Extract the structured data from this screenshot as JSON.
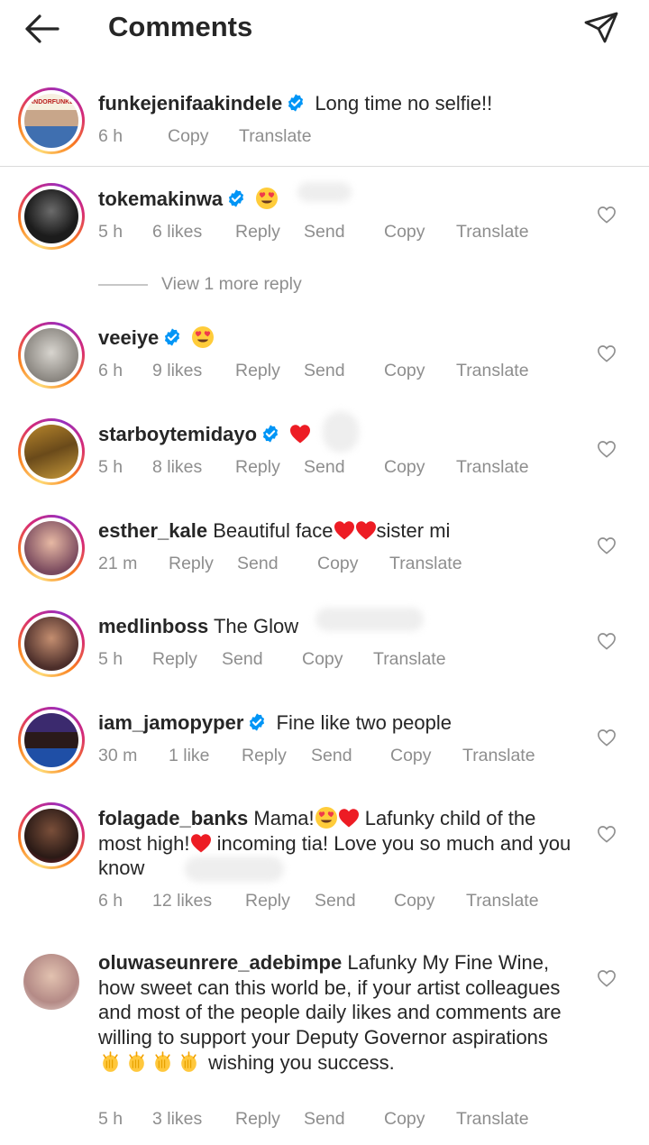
{
  "header": {
    "title": "Comments"
  },
  "caption": {
    "username": "funkejenifaakindele",
    "text": "Long time no selfie!!",
    "time": "6 h",
    "copy": "Copy",
    "translate": "Translate",
    "avatar_text": "ANDORFUNKE"
  },
  "comments": [
    {
      "username": "tokemakinwa",
      "time": "5 h",
      "likes": "6 likes",
      "reply": "Reply",
      "send": "Send",
      "copy": "Copy",
      "translate": "Translate"
    },
    {
      "username": "veeiye",
      "time": "6 h",
      "likes": "9 likes",
      "reply": "Reply",
      "send": "Send",
      "copy": "Copy",
      "translate": "Translate"
    },
    {
      "username": "starboytemidayo",
      "time": "5 h",
      "likes": "8 likes",
      "reply": "Reply",
      "send": "Send",
      "copy": "Copy",
      "translate": "Translate"
    },
    {
      "username": "esther_kale",
      "text_a": "Beautiful face",
      "text_b": "sister mi",
      "time": "21 m",
      "reply": "Reply",
      "send": "Send",
      "copy": "Copy",
      "translate": "Translate"
    },
    {
      "username": "medlinboss",
      "text": "The Glow",
      "time": "5 h",
      "reply": "Reply",
      "send": "Send",
      "copy": "Copy",
      "translate": "Translate"
    },
    {
      "username": "iam_jamopyper",
      "text": "Fine like two people",
      "time": "30 m",
      "likes": "1 like",
      "reply": "Reply",
      "send": "Send",
      "copy": "Copy",
      "translate": "Translate"
    },
    {
      "username": "folagade_banks",
      "text_a": "Mama!",
      "text_b": "Lafunky child of the most high!",
      "text_c": "incoming tia! Love you so much and you know",
      "time": "6 h",
      "likes": "12 likes",
      "reply": "Reply",
      "send": "Send",
      "copy": "Copy",
      "translate": "Translate"
    },
    {
      "username": "oluwaseunrere_adebimpe",
      "text_a": "Lafunky My Fine Wine, how sweet can this world be, if your artist colleagues and most of the people daily likes and comments are willing to support your Deputy Governor aspirations",
      "text_b": "wishing you success.",
      "time": "5 h",
      "likes": "3 likes",
      "reply": "Reply",
      "send": "Send",
      "copy": "Copy",
      "translate": "Translate"
    }
  ],
  "view_more": {
    "label": "View 1 more reply"
  },
  "colors": {
    "text": "#262626",
    "secondary": "#8e8e8e",
    "verified": "#0095f6",
    "heart": "#ed1c24",
    "divider": "#dbdbdb"
  },
  "icons": {
    "back": "arrow-left-icon",
    "share": "paper-plane-icon",
    "like": "heart-outline-icon",
    "verified": "verified-badge-icon"
  }
}
